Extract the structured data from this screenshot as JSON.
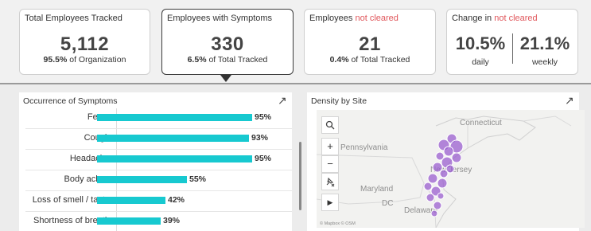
{
  "kpis": {
    "total": {
      "title": "Total Employees Tracked",
      "value": "5,112",
      "sub_bold": "95.5%",
      "sub_rest": " of Organization"
    },
    "symptoms": {
      "title": "Employees with Symptoms",
      "value": "330",
      "sub_bold": "6.5%",
      "sub_rest": " of Total Tracked"
    },
    "not_cleared": {
      "title_prefix": "Employees ",
      "title_highlight": "not cleared",
      "value": "21",
      "sub_bold": "0.4%",
      "sub_rest": " of Total Tracked"
    },
    "change": {
      "title_prefix": "Change in ",
      "title_highlight": "not cleared",
      "daily_value": "10.5%",
      "daily_label": "daily",
      "weekly_value": "21.1%",
      "weekly_label": "weekly"
    }
  },
  "symptoms_panel": {
    "title": "Occurrence of Symptoms",
    "expand_icon": "arrow-up-right",
    "rows": [
      {
        "label": "Fever",
        "value": 95,
        "display": "95%"
      },
      {
        "label": "Cough",
        "value": 93,
        "display": "93%"
      },
      {
        "label": "Headache",
        "value": 95,
        "display": "95%"
      },
      {
        "label": "Body aches",
        "value": 55,
        "display": "55%"
      },
      {
        "label": "Loss of smell / taste",
        "value": 42,
        "display": "42%"
      },
      {
        "label": "Shortness of breath",
        "value": 39,
        "display": "39%"
      }
    ]
  },
  "map_panel": {
    "title": "Density by Site",
    "expand_icon": "arrow-up-right",
    "labels": {
      "connecticut": "Connecticut",
      "pennsylvania": "Pennsylvania",
      "new_jersey": "New Jersey",
      "maryland": "Maryland",
      "dc": "DC",
      "delaware": "Delaware"
    },
    "attribution": "© Mapbox © OSM",
    "controls": {
      "search": "search-icon",
      "zoom_in": "+",
      "zoom_out": "−",
      "pin": "pin-icon",
      "play": "▶"
    }
  },
  "colors": {
    "accent_bar": "#17c9d0",
    "highlight_red": "#e0565b",
    "dot_purple": "#9b5fd0"
  }
}
